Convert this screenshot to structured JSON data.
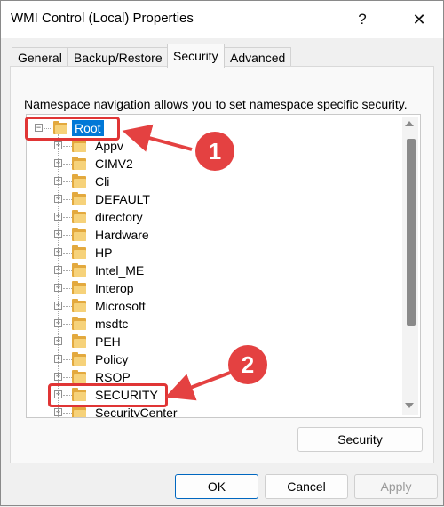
{
  "window": {
    "title": "WMI Control (Local) Properties",
    "help_label": "?",
    "close_label": "✕"
  },
  "tabs": [
    {
      "label": "General",
      "active": false
    },
    {
      "label": "Backup/Restore",
      "active": false
    },
    {
      "label": "Security",
      "active": true
    },
    {
      "label": "Advanced",
      "active": false
    }
  ],
  "security_tab": {
    "description": "Namespace navigation allows you to set namespace specific security.",
    "tree": {
      "root": {
        "label": "Root",
        "expanded": true,
        "selected": true
      },
      "children": [
        "Appv",
        "CIMV2",
        "Cli",
        "DEFAULT",
        "directory",
        "Hardware",
        "HP",
        "Intel_ME",
        "Interop",
        "Microsoft",
        "msdtc",
        "PEH",
        "Policy",
        "RSOP",
        "SECURITY",
        "SecurityCenter"
      ]
    },
    "security_button_label": "Security"
  },
  "footer": {
    "ok_label": "OK",
    "cancel_label": "Cancel",
    "apply_label": "Apply"
  },
  "annotations": {
    "badge_1": "1",
    "badge_2": "2",
    "accent_color": "#e44141"
  }
}
